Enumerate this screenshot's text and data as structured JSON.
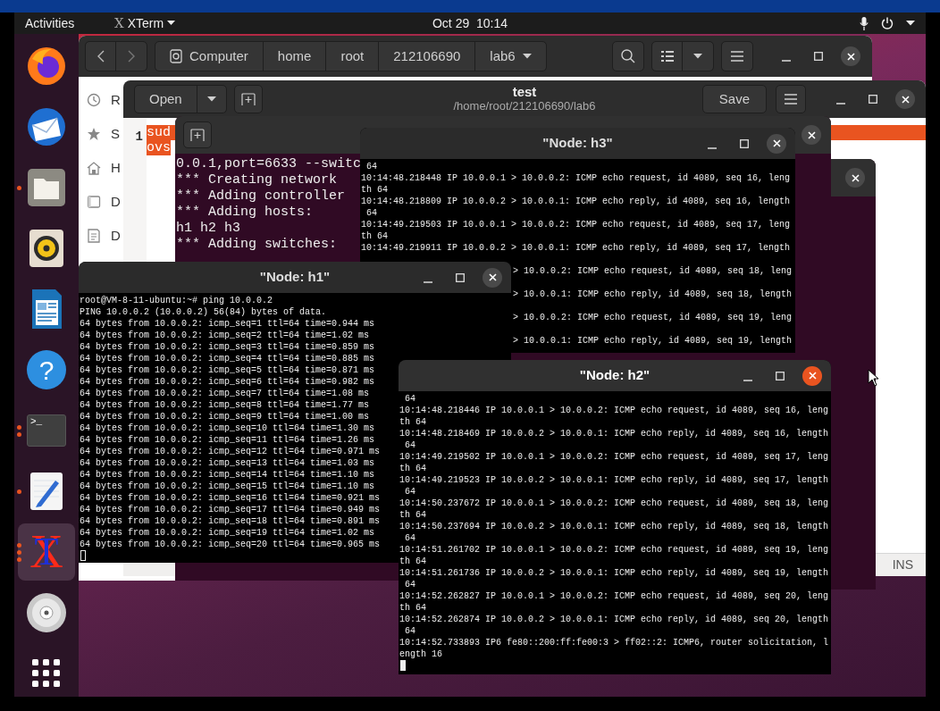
{
  "top_bar": {
    "activities": "Activities",
    "app_glyph": "X",
    "app_menu": "XTerm",
    "clock": "Oct 29  10:14"
  },
  "dock": [
    {
      "kind": "firefox",
      "selected": false
    },
    {
      "kind": "mail",
      "selected": false
    },
    {
      "kind": "files",
      "indicators": [
        {
          "kind": "dot"
        }
      ],
      "selected": false
    },
    {
      "kind": "music",
      "selected": false
    },
    {
      "kind": "writer",
      "selected": false
    },
    {
      "kind": "help",
      "glyph": "?",
      "selected": false
    },
    {
      "kind": "terminal",
      "glyph": ">_",
      "indicators": [
        {
          "kind": "dot"
        },
        {
          "kind": "dot"
        }
      ],
      "selected": false
    },
    {
      "kind": "editor",
      "indicators": [
        {
          "kind": "dot"
        }
      ],
      "selected": false
    },
    {
      "kind": "xterm",
      "glyphs": [
        "X",
        "T"
      ],
      "indicators": [
        {
          "kind": "dot"
        },
        {
          "kind": "dot"
        },
        {
          "kind": "dot"
        }
      ],
      "selected": true
    },
    {
      "kind": "disc",
      "selected": false
    },
    {
      "kind": "apps",
      "selected": false
    }
  ],
  "files_window": {
    "path": [
      "Computer",
      "home",
      "root",
      "212106690",
      "lab6"
    ],
    "sidebar": [
      {
        "kind": "recent",
        "label": "R"
      },
      {
        "kind": "starred",
        "label": "S"
      },
      {
        "kind": "home",
        "label": "H"
      },
      {
        "kind": "desktop",
        "label": "D"
      },
      {
        "kind": "documents",
        "label": "D"
      }
    ]
  },
  "editor_window": {
    "open": "Open",
    "title": "test",
    "subtitle": "/home/root/212106690/lab6",
    "save": "Save",
    "line_number": "1",
    "lines": [
      "sud",
      "ovs"
    ],
    "mode": "INS"
  },
  "mininet_window": {
    "lines": [
      "0.0.1,port=6633 --switc",
      "*** Creating network",
      "*** Adding controller",
      "*** Adding hosts:",
      "h1 h2 h3",
      "*** Adding switches:"
    ]
  },
  "terminals": [
    {
      "title": "\"Node: h3\"",
      "focused": false,
      "lines": [
        {
          "kind": "full",
          "text": " 64"
        },
        {
          "kind": "full",
          "text": "10:14:48.218448 IP 10.0.0.1 > 10.0.0.2: ICMP echo request, id 4089, seq 16, leng"
        },
        {
          "kind": "full",
          "text": "th 64"
        },
        {
          "kind": "full",
          "text": "10:14:48.218809 IP 10.0.0.2 > 10.0.0.1: ICMP echo reply, id 4089, seq 16, length"
        },
        {
          "kind": "full",
          "text": " 64"
        },
        {
          "kind": "full",
          "text": "10:14:49.219503 IP 10.0.0.1 > 10.0.0.2: ICMP echo request, id 4089, seq 17, leng"
        },
        {
          "kind": "full",
          "text": "th 64"
        },
        {
          "kind": "full",
          "text": "10:14:49.219911 IP 10.0.0.2 > 10.0.0.1: ICMP echo reply, id 4089, seq 17, length"
        },
        {
          "kind": "tail",
          "text": "> 10.0.0.2: ICMP echo request, id 4089, seq 18, leng"
        },
        {
          "kind": "tail",
          "text": "> 10.0.0.1: ICMP echo reply, id 4089, seq 18, length"
        },
        {
          "kind": "tail",
          "text": "> 10.0.0.2: ICMP echo request, id 4089, seq 19, leng"
        },
        {
          "kind": "tail",
          "text": "> 10.0.0.1: ICMP echo reply, id 4089, seq 19, length"
        }
      ]
    },
    {
      "title": "\"Node: h1\"",
      "focused": false,
      "cursor": {
        "filled": false
      },
      "lines": [
        {
          "kind": "full",
          "text": "root@VM-8-11-ubuntu:~# ping 10.0.0.2"
        },
        {
          "kind": "full",
          "text": "PING 10.0.0.2 (10.0.0.2) 56(84) bytes of data."
        },
        {
          "kind": "full",
          "text": "64 bytes from 10.0.0.2: icmp_seq=1 ttl=64 time=0.944 ms"
        },
        {
          "kind": "full",
          "text": "64 bytes from 10.0.0.2: icmp_seq=2 ttl=64 time=1.02 ms"
        },
        {
          "kind": "full",
          "text": "64 bytes from 10.0.0.2: icmp_seq=3 ttl=64 time=0.859 ms"
        },
        {
          "kind": "full",
          "text": "64 bytes from 10.0.0.2: icmp_seq=4 ttl=64 time=0.885 ms"
        },
        {
          "kind": "full",
          "text": "64 bytes from 10.0.0.2: icmp_seq=5 ttl=64 time=0.871 ms"
        },
        {
          "kind": "full",
          "text": "64 bytes from 10.0.0.2: icmp_seq=6 ttl=64 time=0.982 ms"
        },
        {
          "kind": "full",
          "text": "64 bytes from 10.0.0.2: icmp_seq=7 ttl=64 time=1.08 ms"
        },
        {
          "kind": "full",
          "text": "64 bytes from 10.0.0.2: icmp_seq=8 ttl=64 time=1.77 ms"
        },
        {
          "kind": "full",
          "text": "64 bytes from 10.0.0.2: icmp_seq=9 ttl=64 time=1.00 ms"
        },
        {
          "kind": "full",
          "text": "64 bytes from 10.0.0.2: icmp_seq=10 ttl=64 time=1.30 ms"
        },
        {
          "kind": "full",
          "text": "64 bytes from 10.0.0.2: icmp_seq=11 ttl=64 time=1.26 ms"
        },
        {
          "kind": "full",
          "text": "64 bytes from 10.0.0.2: icmp_seq=12 ttl=64 time=0.971 ms"
        },
        {
          "kind": "full",
          "text": "64 bytes from 10.0.0.2: icmp_seq=13 ttl=64 time=1.03 ms"
        },
        {
          "kind": "full",
          "text": "64 bytes from 10.0.0.2: icmp_seq=14 ttl=64 time=1.10 ms"
        },
        {
          "kind": "full",
          "text": "64 bytes from 10.0.0.2: icmp_seq=15 ttl=64 time=1.10 ms"
        },
        {
          "kind": "full",
          "text": "64 bytes from 10.0.0.2: icmp_seq=16 ttl=64 time=0.921 ms"
        },
        {
          "kind": "full",
          "text": "64 bytes from 10.0.0.2: icmp_seq=17 ttl=64 time=0.949 ms"
        },
        {
          "kind": "full",
          "text": "64 bytes from 10.0.0.2: icmp_seq=18 ttl=64 time=0.891 ms"
        },
        {
          "kind": "full",
          "text": "64 bytes from 10.0.0.2: icmp_seq=19 ttl=64 time=1.02 ms"
        },
        {
          "kind": "full",
          "text": "64 bytes from 10.0.0.2: icmp_seq=20 ttl=64 time=0.965 ms"
        }
      ]
    },
    {
      "title": "\"Node: h2\"",
      "focused": true,
      "cursor": {
        "filled": true
      },
      "lines": [
        {
          "kind": "full",
          "text": " 64"
        },
        {
          "kind": "full",
          "text": "10:14:48.218446 IP 10.0.0.1 > 10.0.0.2: ICMP echo request, id 4089, seq 16, leng"
        },
        {
          "kind": "full",
          "text": "th 64"
        },
        {
          "kind": "full",
          "text": "10:14:48.218469 IP 10.0.0.2 > 10.0.0.1: ICMP echo reply, id 4089, seq 16, length"
        },
        {
          "kind": "full",
          "text": " 64"
        },
        {
          "kind": "full",
          "text": "10:14:49.219502 IP 10.0.0.1 > 10.0.0.2: ICMP echo request, id 4089, seq 17, leng"
        },
        {
          "kind": "full",
          "text": "th 64"
        },
        {
          "kind": "full",
          "text": "10:14:49.219523 IP 10.0.0.2 > 10.0.0.1: ICMP echo reply, id 4089, seq 17, length"
        },
        {
          "kind": "full",
          "text": " 64"
        },
        {
          "kind": "full",
          "text": "10:14:50.237672 IP 10.0.0.1 > 10.0.0.2: ICMP echo request, id 4089, seq 18, leng"
        },
        {
          "kind": "full",
          "text": "th 64"
        },
        {
          "kind": "full",
          "text": "10:14:50.237694 IP 10.0.0.2 > 10.0.0.1: ICMP echo reply, id 4089, seq 18, length"
        },
        {
          "kind": "full",
          "text": " 64"
        },
        {
          "kind": "full",
          "text": "10:14:51.261702 IP 10.0.0.1 > 10.0.0.2: ICMP echo request, id 4089, seq 19, leng"
        },
        {
          "kind": "full",
          "text": "th 64"
        },
        {
          "kind": "full",
          "text": "10:14:51.261736 IP 10.0.0.2 > 10.0.0.1: ICMP echo reply, id 4089, seq 19, length"
        },
        {
          "kind": "full",
          "text": " 64"
        },
        {
          "kind": "full",
          "text": "10:14:52.262827 IP 10.0.0.1 > 10.0.0.2: ICMP echo request, id 4089, seq 20, leng"
        },
        {
          "kind": "full",
          "text": "th 64"
        },
        {
          "kind": "full",
          "text": "10:14:52.262874 IP 10.0.0.2 > 10.0.0.1: ICMP echo reply, id 4089, seq 20, length"
        },
        {
          "kind": "full",
          "text": " 64"
        },
        {
          "kind": "full",
          "text": "10:14:52.733893 IP6 fe80::200:ff:fe00:3 > ff02::2: ICMP6, router solicitation, l"
        },
        {
          "kind": "full",
          "text": "ength 16"
        }
      ]
    }
  ]
}
